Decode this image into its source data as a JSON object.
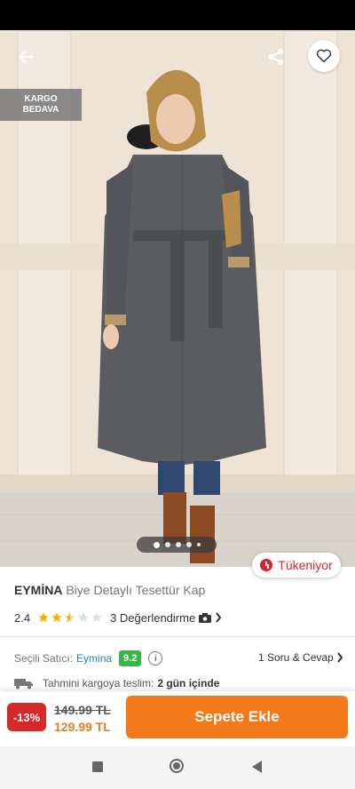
{
  "badges": {
    "cargo_line1": "KARGO",
    "cargo_line2": "BEDAVA",
    "stock": "Tükeniyor"
  },
  "carousel": {
    "image_count": 5,
    "active_index": 0
  },
  "product": {
    "brand": "EYMİNA",
    "name": "Biye Detaylı Tesettür Kap",
    "rating": "2.4",
    "rating_value": 2.4,
    "reviews": "3 Değerlendirme",
    "review_icon": "camera-icon"
  },
  "seller": {
    "label": "Seçili Satıcı:",
    "name": "Eymina",
    "score": "9.2",
    "qa": "1 Soru & Cevap"
  },
  "delivery": {
    "label": "Tahmini kargoya teslim:",
    "value": "2 gün içinde"
  },
  "cart": {
    "discount": "-13%",
    "old_price": "149.99 TL",
    "new_price": "129.99 TL",
    "button": "Sepete Ekle"
  },
  "colors": {
    "accent": "#f27a1a",
    "discount": "#d62a2a",
    "score": "#39b54a",
    "seller_link": "#2a7ac6"
  }
}
